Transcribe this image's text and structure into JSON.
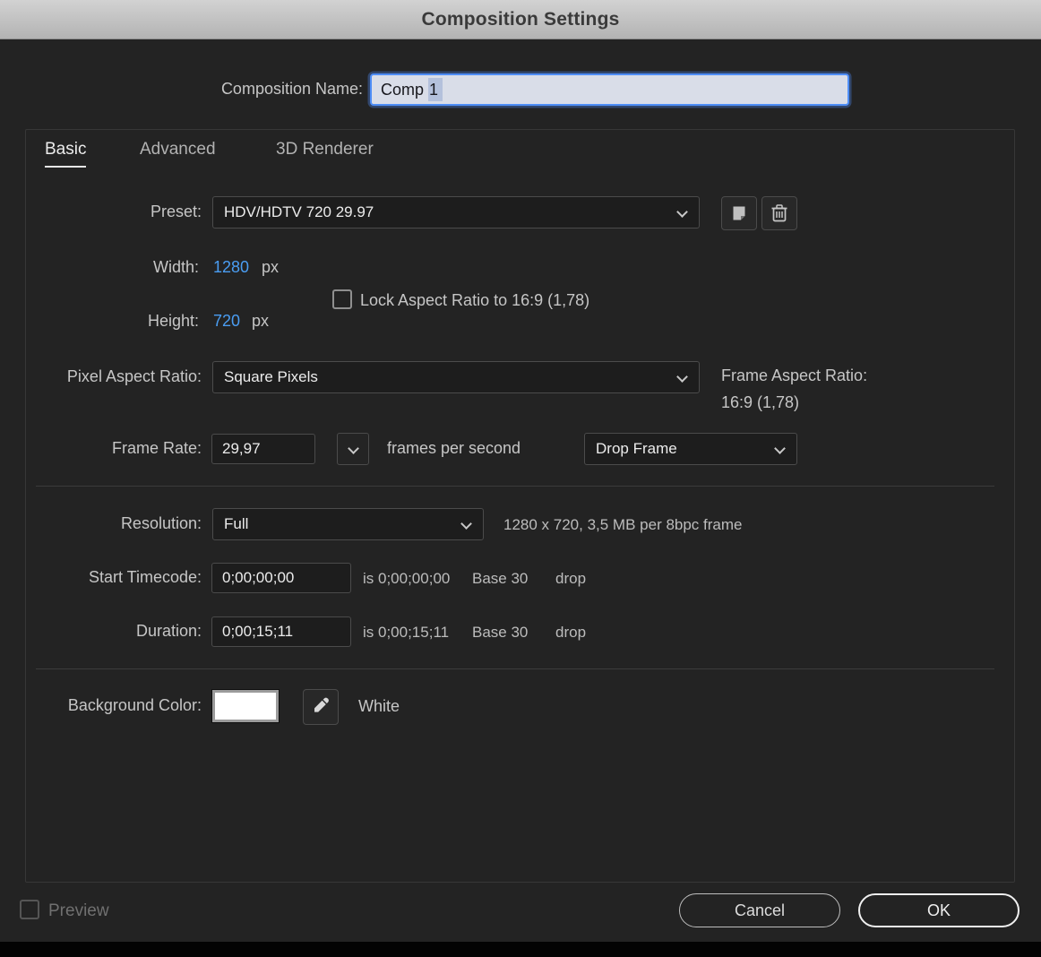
{
  "window": {
    "title": "Composition Settings"
  },
  "composition_name": {
    "label": "Composition Name:",
    "value": "Comp 1",
    "value_before_selection": "Comp ",
    "selected_text": "1"
  },
  "tabs": [
    {
      "label": "Basic",
      "active": true
    },
    {
      "label": "Advanced",
      "active": false
    },
    {
      "label": "3D Renderer",
      "active": false
    }
  ],
  "preset": {
    "label": "Preset:",
    "value": "HDV/HDTV 720 29.97"
  },
  "dimensions": {
    "width_label": "Width:",
    "width_value": "1280",
    "width_unit": "px",
    "height_label": "Height:",
    "height_value": "720",
    "height_unit": "px",
    "lock_aspect_label": "Lock Aspect Ratio to 16:9 (1,78)",
    "lock_aspect_checked": false
  },
  "pixel_aspect_ratio": {
    "label": "Pixel Aspect Ratio:",
    "value": "Square Pixels"
  },
  "frame_aspect_ratio": {
    "label": "Frame Aspect Ratio:",
    "value": "16:9 (1,78)"
  },
  "frame_rate": {
    "label": "Frame Rate:",
    "value": "29,97",
    "suffix": "frames per second",
    "drop_frame_value": "Drop Frame"
  },
  "resolution": {
    "label": "Resolution:",
    "value": "Full",
    "info": "1280 x 720, 3,5 MB per 8bpc frame"
  },
  "start_timecode": {
    "label": "Start Timecode:",
    "value": "0;00;00;00",
    "is_text": "is 0;00;00;00",
    "base_text": "Base 30",
    "drop_text": "drop"
  },
  "duration": {
    "label": "Duration:",
    "value": "0;00;15;11",
    "is_text": "is 0;00;15;11",
    "base_text": "Base 30",
    "drop_text": "drop"
  },
  "background_color": {
    "label": "Background Color:",
    "swatch_color": "#ffffff",
    "color_name": "White"
  },
  "footer": {
    "preview_label": "Preview",
    "preview_checked": false,
    "cancel_label": "Cancel",
    "ok_label": "OK"
  },
  "icons": {
    "preset_save": "save-preset-icon",
    "preset_delete": "trash-icon",
    "frame_rate_menu": "chevron-down-icon",
    "background_picker": "eyedropper-icon"
  },
  "colors": {
    "dialog_background": "#232323",
    "titlebar_text": "#3a3a3a",
    "value_blue": "#4a9df2",
    "selection_border_blue": "#4f8ef7",
    "swatch_white": "#ffffff"
  }
}
